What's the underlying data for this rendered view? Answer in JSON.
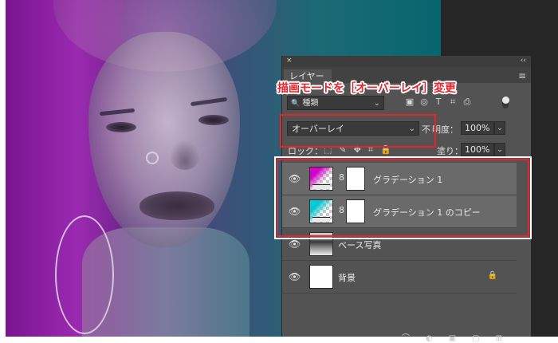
{
  "callout": {
    "text": "描画モードを［オーバーレイ］変更"
  },
  "panel": {
    "close": "×",
    "collapse": "‹‹",
    "tab_label": "レイヤー",
    "menu_icon": "≡",
    "filter": {
      "search_icon": "🔍",
      "label": "種類",
      "chevron": "⌄",
      "icons": [
        "▣",
        "◎",
        "T",
        "⌗",
        "⎙"
      ]
    },
    "blend_mode": {
      "value": "オーバーレイ",
      "chevron": "⌄"
    },
    "opacity": {
      "label_cut": "不",
      "label": "明度：",
      "value": "100%"
    },
    "lock": {
      "label": "ロック：",
      "icons": [
        "⬚",
        "✎",
        "✥",
        "⌗",
        "🔒"
      ]
    },
    "fill": {
      "label": "塗り：",
      "value": "100%"
    },
    "layers": [
      {
        "name": "グラデーション 1",
        "thumb": "gradient-magenta",
        "visible": true,
        "selected": true,
        "has_mask": true
      },
      {
        "name": "グラデーション 1 のコピー",
        "thumb": "gradient-cyan",
        "visible": true,
        "selected": true,
        "has_mask": true
      },
      {
        "name": "ベース写真",
        "thumb": "photo",
        "visible": true,
        "selected": false,
        "has_mask": false
      },
      {
        "name": "背景",
        "thumb": "white",
        "visible": true,
        "selected": false,
        "has_mask": false,
        "locked": true
      }
    ],
    "eye_icon": "👁",
    "link_icon": "8",
    "lock_icon": "🔒"
  },
  "colors": {
    "highlight_red": "#e8232a",
    "panel_bg": "#535353",
    "selected_layer_bg": "#6a6a6a"
  }
}
